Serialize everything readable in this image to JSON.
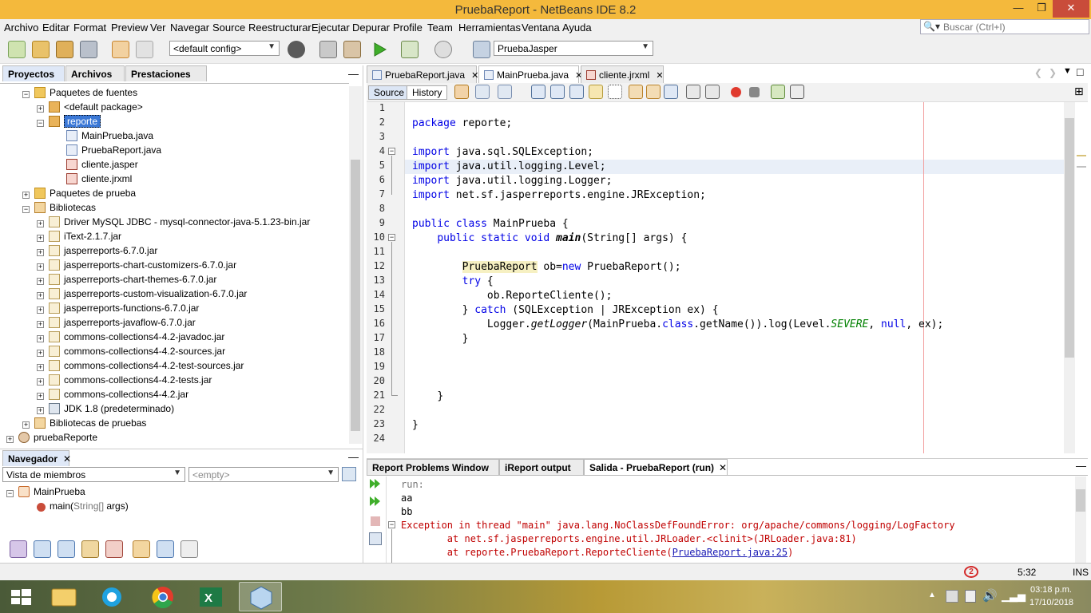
{
  "window": {
    "title": "PruebaReport - NetBeans IDE 8.2",
    "minimize": "—",
    "restore": "❐",
    "close": "✕"
  },
  "menu": [
    "Archivo",
    "Editar",
    "Format",
    "Preview",
    "Ver",
    "Navegar",
    "Source",
    "Reestructurar",
    "Ejecutar",
    "Depurar",
    "Profile",
    "Team",
    "Herramientas",
    "Ventana",
    "Ayuda"
  ],
  "search": {
    "placeholder": "Buscar (Ctrl+I)"
  },
  "toolbar": {
    "config": "<default config>",
    "project": "PruebaJasper"
  },
  "left_tabs": {
    "projects": "Proyectos",
    "files": "Archivos",
    "services": "Prestaciones"
  },
  "tree": [
    {
      "label": "Paquetes de fuentes",
      "icon": "folder"
    },
    {
      "label": "<default package>",
      "icon": "pkg"
    },
    {
      "label": "reporte",
      "icon": "pkg"
    },
    {
      "label": "MainPrueba.java",
      "icon": "java"
    },
    {
      "label": "PruebaReport.java",
      "icon": "java"
    },
    {
      "label": "cliente.jasper",
      "icon": "rpt"
    },
    {
      "label": "cliente.jrxml",
      "icon": "rpt"
    },
    {
      "label": "Paquetes de prueba",
      "icon": "folder"
    },
    {
      "label": "Bibliotecas",
      "icon": "lib"
    },
    {
      "label": "Driver MySQL JDBC  - mysql-connector-java-5.1.23-bin.jar",
      "icon": "jar"
    },
    {
      "label": "iText-2.1.7.jar",
      "icon": "jar"
    },
    {
      "label": "jasperreports-6.7.0.jar",
      "icon": "jar"
    },
    {
      "label": "jasperreports-chart-customizers-6.7.0.jar",
      "icon": "jar"
    },
    {
      "label": "jasperreports-chart-themes-6.7.0.jar",
      "icon": "jar"
    },
    {
      "label": "jasperreports-custom-visualization-6.7.0.jar",
      "icon": "jar"
    },
    {
      "label": "jasperreports-functions-6.7.0.jar",
      "icon": "jar"
    },
    {
      "label": "jasperreports-javaflow-6.7.0.jar",
      "icon": "jar"
    },
    {
      "label": "commons-collections4-4.2-javadoc.jar",
      "icon": "jar"
    },
    {
      "label": "commons-collections4-4.2-sources.jar",
      "icon": "jar"
    },
    {
      "label": "commons-collections4-4.2-test-sources.jar",
      "icon": "jar"
    },
    {
      "label": "commons-collections4-4.2-tests.jar",
      "icon": "jar"
    },
    {
      "label": "commons-collections4-4.2.jar",
      "icon": "jar"
    },
    {
      "label": "JDK 1.8 (predeterminado)",
      "icon": "jdk"
    },
    {
      "label": "Bibliotecas de pruebas",
      "icon": "lib"
    },
    {
      "label": "pruebaReporte",
      "icon": "proj"
    }
  ],
  "navigator": {
    "title": "Navegador",
    "view_combo": "Vista de miembros",
    "filter_combo": "<empty>",
    "class": "MainPrueba",
    "method": "main(",
    "method_params": "String[]",
    "method_end": " args)"
  },
  "editor_tabs": [
    {
      "label": "PruebaReport.java"
    },
    {
      "label": "MainPrueba.java"
    },
    {
      "label": "cliente.jrxml"
    }
  ],
  "source_tabs": {
    "source": "Source",
    "history": "History"
  },
  "code": {
    "package_kw": "package",
    "package_name": " reporte;",
    "import_kw": "import",
    "imp1": " java.sql.SQLException;",
    "imp2": " java.util.logging.Level;",
    "imp3": " java.util.logging.Logger;",
    "imp4": " net.sf.jasperreports.engine.JRException;",
    "public_class": "public class",
    "class_name": " MainPrueba {",
    "public_static_void": "public static void",
    "main": "main",
    "main_args": "(String[] args) {",
    "pr_cls": "PruebaReport",
    "ob": " ob=",
    "new_kw": "new",
    "pr_ctor": " PruebaReport();",
    "try_kw": "try",
    "brace": " {",
    "call": "ob.ReporteCliente();",
    "catch_open": "} ",
    "catch_kw": "catch",
    "catch_args": " (SQLException | JRException ex) {",
    "logger1": "Logger.",
    "getLogger": "getLogger",
    "logger2": "(MainPrueba.",
    "class_kw": "class",
    "logger3": ".getName()).log(Level.",
    "severe": "SEVERE",
    "comma": ", ",
    "null_kw": "null",
    "logger4": ", ex);",
    "close": "}"
  },
  "line_numbers": [
    "1",
    "2",
    "3",
    "4",
    "5",
    "6",
    "7",
    "8",
    "9",
    "10",
    "11",
    "12",
    "13",
    "14",
    "15",
    "16",
    "17",
    "18",
    "19",
    "20",
    "21",
    "22",
    "23",
    "24"
  ],
  "output_tabs": {
    "report_problems": "Report Problems Window",
    "ireport": "iReport output",
    "salida": "Salida - PruebaReport (run)"
  },
  "output": {
    "run": "run:",
    "aa": "aa",
    "bb": "bb",
    "exc": "Exception in thread \"main\" java.lang.NoClassDefFoundError: org/apache/commons/logging/LogFactory",
    "at1": "        at net.sf.jasperreports.engine.util.JRLoader.<clinit>(JRLoader.java:81)",
    "at2_pre": "        at reporte.PruebaReport.ReporteCliente(",
    "at2_link": "PruebaReport.java:25",
    "at2_post": ")"
  },
  "status": {
    "badge": "2",
    "position": "5:32",
    "mode": "INS"
  },
  "taskbar": {
    "time": "03:18 p.m.",
    "date": "17/10/2018"
  },
  "colors": {
    "titlebar": "#f4b93c",
    "keyword": "#0000e6",
    "error_text": "#c00000",
    "selection": "#3b78d6"
  }
}
